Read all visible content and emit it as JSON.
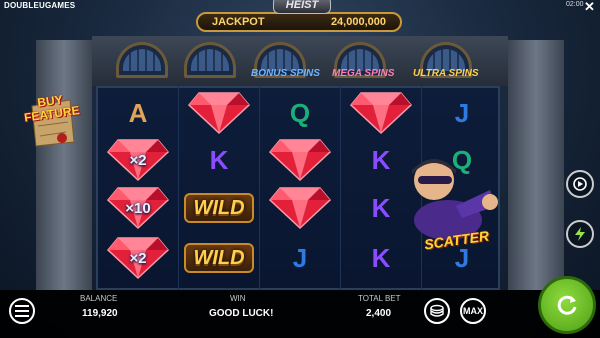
{
  "header": {
    "brand_part1": "DOUBLEU",
    "brand_part2": "GAMES",
    "clock": "02:00",
    "logo_text": "HEIST",
    "jackpot_label": "JACKPOT",
    "jackpot_value": "24,000,000"
  },
  "features": {
    "bonus_spins": "BONUS SPINS",
    "mega_spins": "MEGA SPINS",
    "ultra_spins": "ULTRA SPINS"
  },
  "buy_feature": {
    "line1": "BUY",
    "line2": "FEATURE"
  },
  "reels": {
    "reel1": [
      {
        "symbol": "A",
        "color": "#e0a35a"
      },
      {
        "symbol": "gem",
        "multiplier": "×2"
      },
      {
        "symbol": "gem",
        "multiplier": "×10"
      },
      {
        "symbol": "gem",
        "multiplier": "×2"
      }
    ],
    "reel2": [
      {
        "symbol": "gem"
      },
      {
        "symbol": "K",
        "color": "#8a4cff"
      },
      {
        "symbol": "WILD"
      },
      {
        "symbol": "WILD"
      }
    ],
    "reel3": [
      {
        "symbol": "Q",
        "color": "#1bb07a"
      },
      {
        "symbol": "gem"
      },
      {
        "symbol": "gem"
      },
      {
        "symbol": "J",
        "color": "#2f7ae0"
      }
    ],
    "reel4": [
      {
        "symbol": "gem"
      },
      {
        "symbol": "K",
        "color": "#8a4cff"
      },
      {
        "symbol": "K",
        "color": "#8a4cff"
      },
      {
        "symbol": "K",
        "color": "#8a4cff"
      }
    ],
    "reel5": [
      {
        "symbol": "J",
        "color": "#2f7ae0"
      },
      {
        "symbol": "Q",
        "color": "#1bb07a"
      },
      {
        "symbol": "SCATTER"
      },
      {
        "symbol": "J",
        "color": "#2f7ae0"
      }
    ],
    "wild_label": "WILD",
    "scatter_label": "SCATTER"
  },
  "footer": {
    "balance_label": "BALANCE",
    "balance_value": "119,920",
    "win_label": "WIN",
    "win_value": "GOOD LUCK!",
    "total_bet_label": "TOTAL BET",
    "total_bet_value": "2,400",
    "max_label": "MAX"
  },
  "icons": {
    "menu": "menu-icon",
    "coins": "coin-stack-icon",
    "spin": "refresh-icon",
    "autoplay": "autoplay-icon",
    "turbo": "lightning-icon",
    "close": "close-icon"
  },
  "colors": {
    "jackpot_gold": "#ffd36b",
    "spin_green": "#6cc52a",
    "gem_red": "#e3203a"
  }
}
